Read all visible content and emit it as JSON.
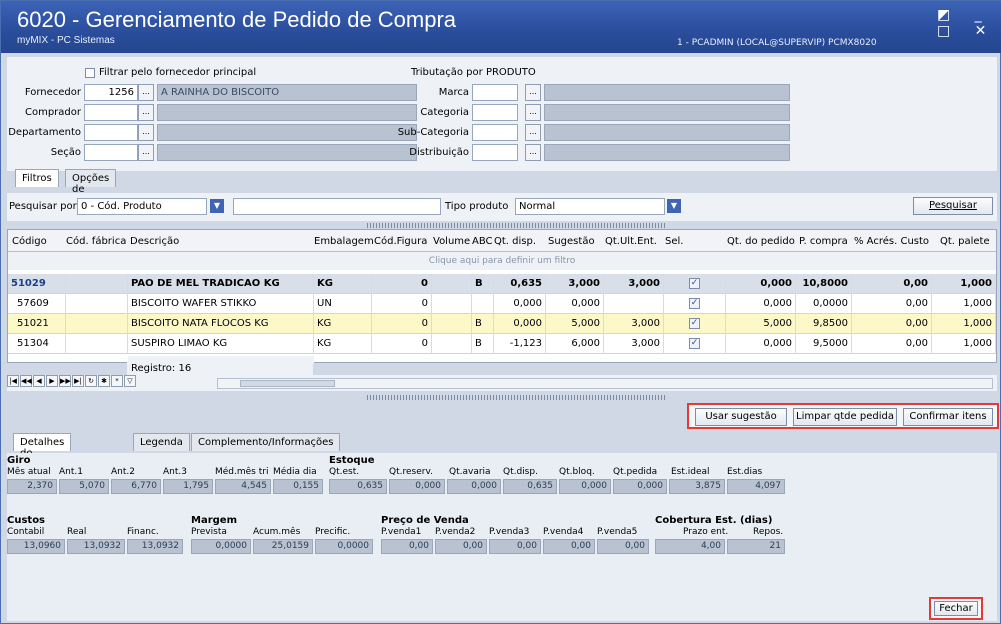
{
  "window": {
    "title": "6020 - Gerenciamento de Pedido de Compra",
    "subtitle": "myMIX - PC Sistemas",
    "userinfo": "1 - PCADMIN (LOCAL@SUPERVIP)   PCMX8020",
    "buttons": "◩ _ □ ✕"
  },
  "filters": {
    "filtrar_label": "Filtrar pelo fornecedor principal",
    "tributacao": "Tributação por PRODUTO",
    "fornecedor_label": "Fornecedor",
    "fornecedor_code": "1256",
    "fornecedor_name": "A RAINHA DO BISCOITO",
    "comprador_label": "Comprador",
    "departamento_label": "Departamento",
    "secao_label": "Seção",
    "marca_label": "Marca",
    "categoria_label": "Categoria",
    "subcategoria_label": "Sub-Categoria",
    "distribuicao_label": "Distribuição",
    "dots": "..."
  },
  "tabs": {
    "filtros": "Filtros",
    "opcoes": "Opções de filtros"
  },
  "search": {
    "pesquisar_por_label": "Pesquisar por",
    "pesquisar_por_value": "0 - Cód. Produto",
    "tipo_label": "Tipo produto",
    "tipo_value": "Normal",
    "button": "Pesquisar"
  },
  "grid": {
    "headers": [
      "Código",
      "Cód. fábrica",
      "Descrição",
      "Embalagem",
      "Cód.Figura",
      "Volume",
      "ABC",
      "Qt. disp.",
      "Sugestão",
      "Qt.Ult.Ent.",
      "Sel.",
      "Qt. do pedido",
      "P. compra",
      "% Acrés. Custo",
      "Qt. palete"
    ],
    "filter_hint": "Clique aqui para definir um filtro",
    "rows": [
      {
        "codigo": "51029",
        "descricao": "PAO DE MEL TRADICAO KG",
        "embalagem": "KG",
        "figura": "0",
        "abc": "B",
        "disp": "0,635",
        "sugestao": "3,000",
        "ultent": "3,000",
        "sel": "✓",
        "pedido": "0,000",
        "compra": "10,8000",
        "acres": "0,00",
        "palete": "1,000"
      },
      {
        "codigo": "57609",
        "descricao": "BISCOITO WAFER STIKKO",
        "embalagem": "UN",
        "figura": "0",
        "abc": "",
        "disp": "0,000",
        "sugestao": "0,000",
        "ultent": "",
        "sel": "✓",
        "pedido": "0,000",
        "compra": "0,0000",
        "acres": "0,00",
        "palete": "1,000"
      },
      {
        "codigo": "51021",
        "descricao": "BISCOITO NATA FLOCOS KG",
        "embalagem": "KG",
        "figura": "0",
        "abc": "B",
        "disp": "0,000",
        "sugestao": "5,000",
        "ultent": "3,000",
        "sel": "✓",
        "pedido": "5,000",
        "compra": "9,8500",
        "acres": "0,00",
        "palete": "1,000"
      },
      {
        "codigo": "51304",
        "descricao": "SUSPIRO LIMAO KG",
        "embalagem": "KG",
        "figura": "0",
        "abc": "B",
        "disp": "-1,123",
        "sugestao": "6,000",
        "ultent": "3,000",
        "sel": "✓",
        "pedido": "0,000",
        "compra": "9,5000",
        "acres": "0,00",
        "palete": "1,000"
      }
    ],
    "registro": "Registro: 16"
  },
  "actions": {
    "usar": "Usar sugestão",
    "limpar": "Limpar qtde pedida",
    "confirmar": "Confirmar itens"
  },
  "detail_tabs": {
    "detalhes": "Detalhes do Produto",
    "legenda": "Legenda",
    "complemento": "Complemento/Informações"
  },
  "giro": {
    "title": "Giro",
    "labels": [
      "Mês atual",
      "Ant.1",
      "Ant.2",
      "Ant.3",
      "Méd.mês tri",
      "Média dia"
    ],
    "values": [
      "2,370",
      "5,070",
      "6,770",
      "1,795",
      "4,545",
      "0,155"
    ]
  },
  "estoque": {
    "title": "Estoque",
    "labels": [
      "Qt.est.",
      "Qt.reserv.",
      "Qt.avaria",
      "Qt.disp.",
      "Qt.bloq.",
      "Qt.pedida",
      "Est.ideal",
      "Est.dias"
    ],
    "values": [
      "0,635",
      "0,000",
      "0,000",
      "0,635",
      "0,000",
      "0,000",
      "3,875",
      "4,097"
    ]
  },
  "custos": {
    "title": "Custos",
    "labels": [
      "Contabil",
      "Real",
      "Financ."
    ],
    "values": [
      "13,0960",
      "13,0932",
      "13,0932"
    ]
  },
  "margem": {
    "title": "Margem",
    "labels": [
      "Prevista",
      "Acum.mês",
      "Precific."
    ],
    "values": [
      "0,0000",
      "25,0159",
      "0,0000"
    ]
  },
  "preco": {
    "title": "Preço de Venda",
    "labels": [
      "P.venda1",
      "P.venda2",
      "P.venda3",
      "P.venda4",
      "P.venda5"
    ],
    "values": [
      "0,00",
      "0,00",
      "0,00",
      "0,00",
      "0,00"
    ]
  },
  "cobertura": {
    "title": "Cobertura Est. (dias)",
    "labels": [
      "Prazo ent.",
      "Repos."
    ],
    "values": [
      "4,00",
      "21"
    ]
  },
  "fechar": "Fechar"
}
